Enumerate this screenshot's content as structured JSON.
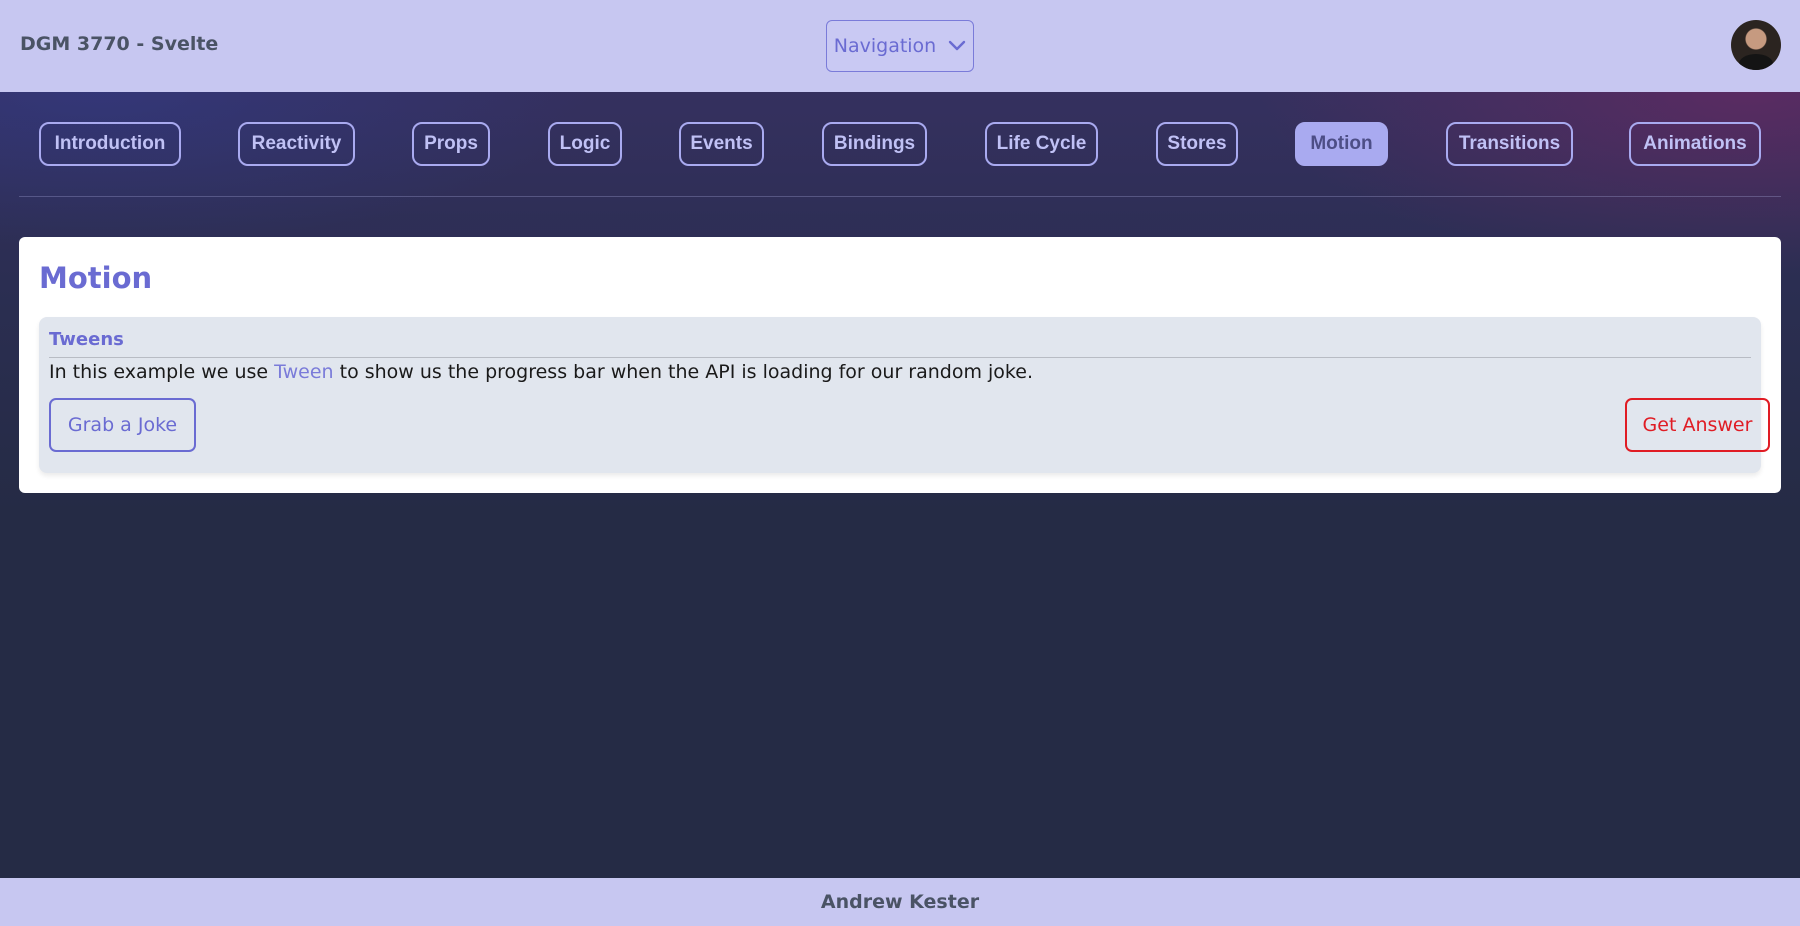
{
  "header": {
    "brand": "DGM 3770 - Svelte",
    "nav_select_label": "Navigation",
    "nav_select_icon": "chevron-down-icon"
  },
  "tabs": [
    {
      "label": "Introduction",
      "active": false
    },
    {
      "label": "Reactivity",
      "active": false
    },
    {
      "label": "Props",
      "active": false
    },
    {
      "label": "Logic",
      "active": false
    },
    {
      "label": "Events",
      "active": false
    },
    {
      "label": "Bindings",
      "active": false
    },
    {
      "label": "Life Cycle",
      "active": false
    },
    {
      "label": "Stores",
      "active": false
    },
    {
      "label": "Motion",
      "active": true
    },
    {
      "label": "Transitions",
      "active": false
    },
    {
      "label": "Animations",
      "active": false
    }
  ],
  "main": {
    "title": "Motion",
    "section": {
      "title": "Tweens",
      "text_before": "In this example we use ",
      "text_link": "Tween",
      "text_after": " to show us the progress bar when the API is loading for our random joke.",
      "grab_button": "Grab a Joke",
      "answer_button": "Get Answer"
    }
  },
  "footer": {
    "author": "Andrew Kester"
  },
  "colors": {
    "accent": "#6a6bd2",
    "header_bg": "#c7c7f1",
    "page_bg": "#252b45",
    "danger": "#e01c24"
  }
}
